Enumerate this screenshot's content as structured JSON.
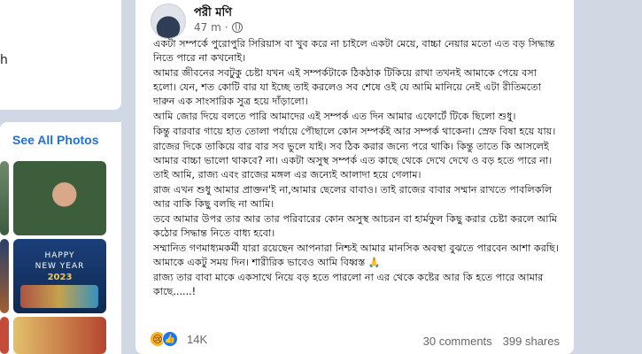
{
  "left": {
    "snippet": "h",
    "see_all_photos": "See All Photos",
    "photo_text": [
      "HAPPY",
      "NEW YEAR",
      "2023"
    ]
  },
  "post": {
    "author": "পরী মণি",
    "time": "47 m",
    "dot": "·",
    "paragraphs": [
      "একটা সম্পর্কে পুরোপুরি সিরিয়াস বা খুব করে না চাইলে একটা মেয়ে, বাচ্চা নেয়ার মতো এত বড় সিদ্ধান্ত নিতে পারে না কখনোই।",
      "আমার জীবনের সবটুকু চেষ্টা যখন এই সম্পর্কটাকে ঠিকঠাক টিকিয়ে রাখা তখনই আমাকে পেয়ে বসা হলো। যেন, শত কোটি বার যা ইচ্ছে তাই করলেও সব শেষে ওই যে আমি মানিয়ে নেই এটা রীতিমতো দারুন এক সাংসারিক সুত্র হয়ে দাঁড়ালো।",
      "আমি জোর দিয়ে বলতে পারি আমাদের এই সম্পর্ক এত দিন আমার এফোর্টে টিকে ছিলো শুধু।",
      "কিন্তু বারবার গায়ে হাত তোলা পর্যায়ে পৌছালে কোন সম্পর্কই আর সম্পর্ক থাকেনা। স্রেফ বিষা হয়ে যায়।",
      "রাজের দিকে তাকিয়ে বার বার সব ভুলে যাই। সব ঠিক করার জন্যে পরে থাকি। কিন্তু তাতে কি আসলেই আমার বাচ্চা ভালো থাকবে? না। একটা অসুস্থ সম্পর্ক এত কাছে থেকে দেখে দেখে ও বড় হতে পারে না। তাই আমি, রাজ্য এবং রাজের মঙ্গল এর জন্যেই আলাদা হয়ে গেলাম।",
      "রাজ এখন শুধু আমার প্রাক্তন'ই না,আমার ছেলের বাবাও। তাই রাজের বাবার সম্মান রাখতে পাবলিকলি আর বাকি কিছু বলছি না আমি।",
      "তবে আমার উপর তার আর তার পরিবারের কোন অসুস্থ আচরন বা হার্মফুল কিছু করার চেষ্টা করলে আমি কঠোর সিদ্ধান্ত নিতে বাধ্য হবো।",
      "সম্মানিত গণমাধ্যমকর্মী যারা রয়েছেন আপনারা নিশ্চই আমার মানসিক অবস্থা বুঝতে পারবেন আশা করছি। আমাকে একটু সময় দিন। শারীরিক ভাবেও আমি বিধ্বস্ত 🙏",
      "রাজ্য তার বাবা মাকে একসাথে নিয়ে বড় হতে পারলো না এর থেকে কষ্টের আর কি হতে পারে আমার কাছে......!"
    ],
    "reactions": {
      "sad_icon": "😢",
      "like_icon": "👍",
      "count": "14K"
    },
    "comments": "30 comments",
    "shares": "399 shares"
  }
}
